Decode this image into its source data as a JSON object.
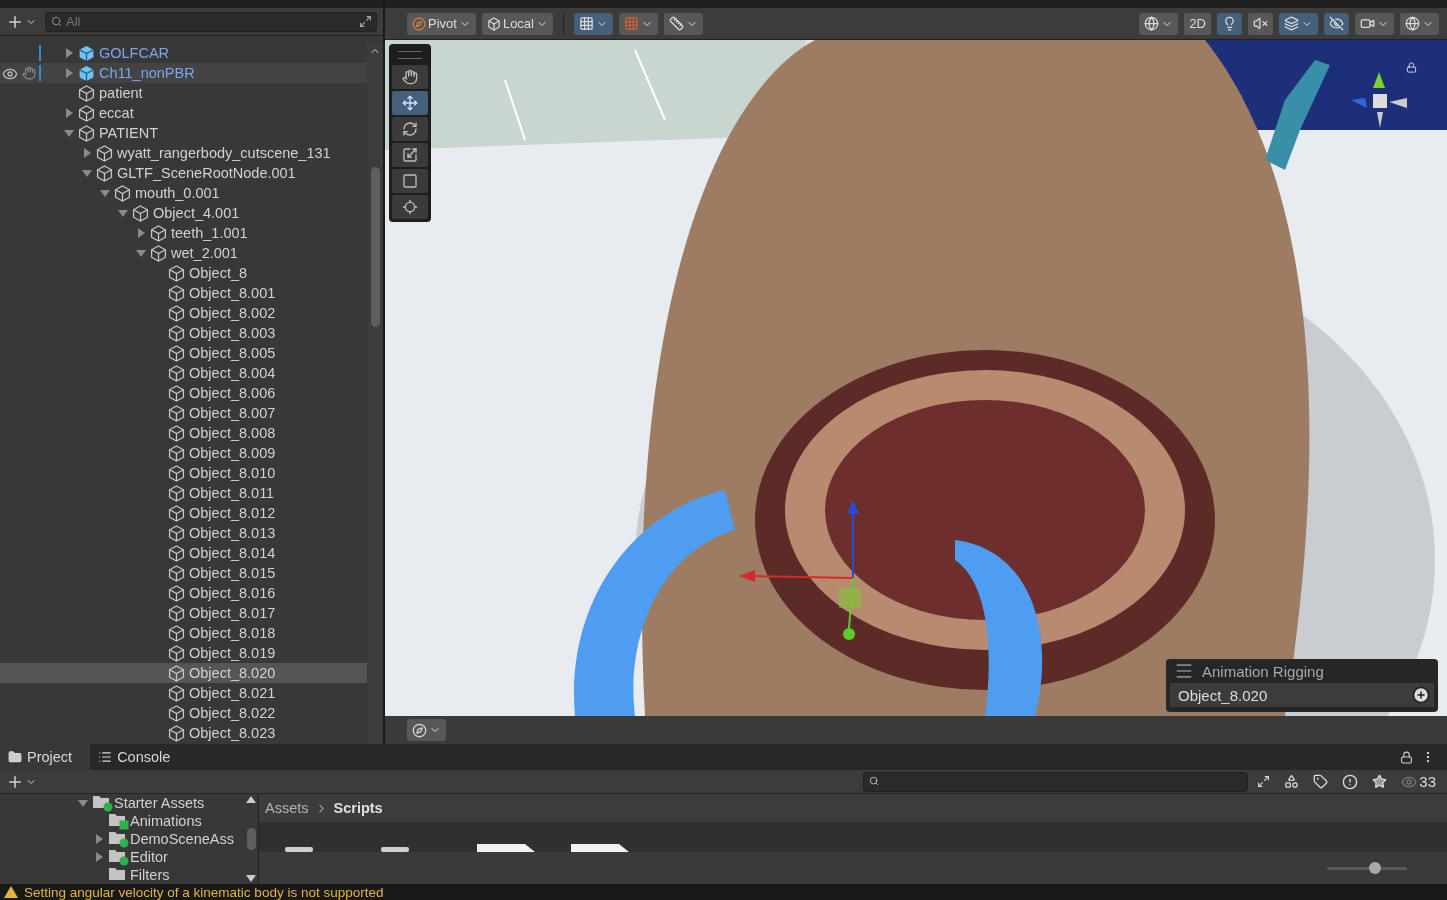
{
  "hierarchy": {
    "search": {
      "placeholder": "All"
    },
    "items": [
      {
        "label": "GOLFCAR",
        "kind": "prefab",
        "expanded": false,
        "selected": false,
        "hovered": false,
        "modified": true
      },
      {
        "label": "Ch11_nonPBR",
        "kind": "prefab",
        "expanded": false,
        "selected": false,
        "hovered": true,
        "modified": true
      },
      {
        "label": "patient",
        "kind": "object",
        "selected": false,
        "hovered": false,
        "modified": false
      },
      {
        "label": "eccat",
        "kind": "object",
        "expanded": false,
        "selected": false,
        "hovered": false,
        "modified": false
      },
      {
        "label": "PATIENT",
        "kind": "object",
        "expanded": true,
        "selected": false,
        "hovered": false,
        "modified": false,
        "children": [
          {
            "label": "wyatt_rangerbody_cutscene_131",
            "kind": "object",
            "expanded": false,
            "selected": false,
            "hovered": false,
            "modified": false
          },
          {
            "label": "GLTF_SceneRootNode.001",
            "kind": "object",
            "expanded": true,
            "selected": false,
            "hovered": false,
            "modified": false,
            "children": [
              {
                "label": "mouth_0.001",
                "kind": "object",
                "expanded": true,
                "selected": false,
                "hovered": false,
                "modified": false,
                "children": [
                  {
                    "label": "Object_4.001",
                    "kind": "object",
                    "expanded": true,
                    "selected": false,
                    "hovered": false,
                    "modified": false,
                    "children": [
                      {
                        "label": "teeth_1.001",
                        "kind": "object",
                        "expanded": false,
                        "selected": false,
                        "hovered": false,
                        "modified": false
                      },
                      {
                        "label": "wet_2.001",
                        "kind": "object",
                        "expanded": true,
                        "selected": false,
                        "hovered": false,
                        "modified": false,
                        "children": [
                          {
                            "label": "Object_8",
                            "kind": "object",
                            "selected": false,
                            "hovered": false,
                            "modified": false
                          },
                          {
                            "label": "Object_8.001",
                            "kind": "object",
                            "selected": false,
                            "hovered": false,
                            "modified": false
                          },
                          {
                            "label": "Object_8.002",
                            "kind": "object",
                            "selected": false,
                            "hovered": false,
                            "modified": false
                          },
                          {
                            "label": "Object_8.003",
                            "kind": "object",
                            "selected": false,
                            "hovered": false,
                            "modified": false
                          },
                          {
                            "label": "Object_8.005",
                            "kind": "object",
                            "selected": false,
                            "hovered": false,
                            "modified": false
                          },
                          {
                            "label": "Object_8.004",
                            "kind": "object",
                            "selected": false,
                            "hovered": false,
                            "modified": false
                          },
                          {
                            "label": "Object_8.006",
                            "kind": "object",
                            "selected": false,
                            "hovered": false,
                            "modified": false
                          },
                          {
                            "label": "Object_8.007",
                            "kind": "object",
                            "selected": false,
                            "hovered": false,
                            "modified": false
                          },
                          {
                            "label": "Object_8.008",
                            "kind": "object",
                            "selected": false,
                            "hovered": false,
                            "modified": false
                          },
                          {
                            "label": "Object_8.009",
                            "kind": "object",
                            "selected": false,
                            "hovered": false,
                            "modified": false
                          },
                          {
                            "label": "Object_8.010",
                            "kind": "object",
                            "selected": false,
                            "hovered": false,
                            "modified": false
                          },
                          {
                            "label": "Object_8.011",
                            "kind": "object",
                            "selected": false,
                            "hovered": false,
                            "modified": false
                          },
                          {
                            "label": "Object_8.012",
                            "kind": "object",
                            "selected": false,
                            "hovered": false,
                            "modified": false
                          },
                          {
                            "label": "Object_8.013",
                            "kind": "object",
                            "selected": false,
                            "hovered": false,
                            "modified": false
                          },
                          {
                            "label": "Object_8.014",
                            "kind": "object",
                            "selected": false,
                            "hovered": false,
                            "modified": false
                          },
                          {
                            "label": "Object_8.015",
                            "kind": "object",
                            "selected": false,
                            "hovered": false,
                            "modified": false
                          },
                          {
                            "label": "Object_8.016",
                            "kind": "object",
                            "selected": false,
                            "hovered": false,
                            "modified": false
                          },
                          {
                            "label": "Object_8.017",
                            "kind": "object",
                            "selected": false,
                            "hovered": false,
                            "modified": false
                          },
                          {
                            "label": "Object_8.018",
                            "kind": "object",
                            "selected": false,
                            "hovered": false,
                            "modified": false
                          },
                          {
                            "label": "Object_8.019",
                            "kind": "object",
                            "selected": false,
                            "hovered": false,
                            "modified": false
                          },
                          {
                            "label": "Object_8.020",
                            "kind": "object",
                            "selected": true,
                            "hovered": false,
                            "modified": false
                          },
                          {
                            "label": "Object_8.021",
                            "kind": "object",
                            "selected": false,
                            "hovered": false,
                            "modified": false
                          },
                          {
                            "label": "Object_8.022",
                            "kind": "object",
                            "selected": false,
                            "hovered": false,
                            "modified": false
                          },
                          {
                            "label": "Object_8.023",
                            "kind": "object",
                            "selected": false,
                            "hovered": false,
                            "modified": false
                          }
                        ]
                      }
                    ]
                  }
                ]
              }
            ]
          }
        ]
      }
    ]
  },
  "scene": {
    "toolbar": {
      "pivot": "Pivot",
      "space": "Local",
      "grid_snap_on": true,
      "mode_2d": "2D",
      "lighting_on": true,
      "audio_on": false,
      "effects_on": true,
      "hidden_on": true
    },
    "tools": [
      {
        "kind": "hand",
        "selected": false
      },
      {
        "kind": "move",
        "selected": true
      },
      {
        "kind": "rotate",
        "selected": false
      },
      {
        "kind": "scale",
        "selected": false
      },
      {
        "kind": "rect",
        "selected": false
      },
      {
        "kind": "transform",
        "selected": false
      }
    ],
    "overlay": {
      "title": "Animation Rigging",
      "field": "Object_8.020"
    }
  },
  "project": {
    "tabs": [
      {
        "label": "Project",
        "kind": "folder",
        "selected": true
      },
      {
        "label": "Console",
        "kind": "console",
        "selected": false
      }
    ],
    "folders": [
      {
        "label": "Starter Assets",
        "expanded": true,
        "kind": "added",
        "children": [
          {
            "label": "Animations",
            "kind": "edited"
          },
          {
            "label": "DemoSceneAss",
            "expanded": false,
            "kind": "added"
          },
          {
            "label": "Editor",
            "expanded": false,
            "kind": "added"
          },
          {
            "label": "Filters",
            "kind": "plain"
          }
        ]
      }
    ],
    "breadcrumb": [
      "Assets",
      "Scripts"
    ],
    "count": "33",
    "zoom": {
      "level": 0.6
    }
  },
  "status": {
    "kind": "warning",
    "message": "Setting angular velocity of a kinematic body is not supported"
  }
}
